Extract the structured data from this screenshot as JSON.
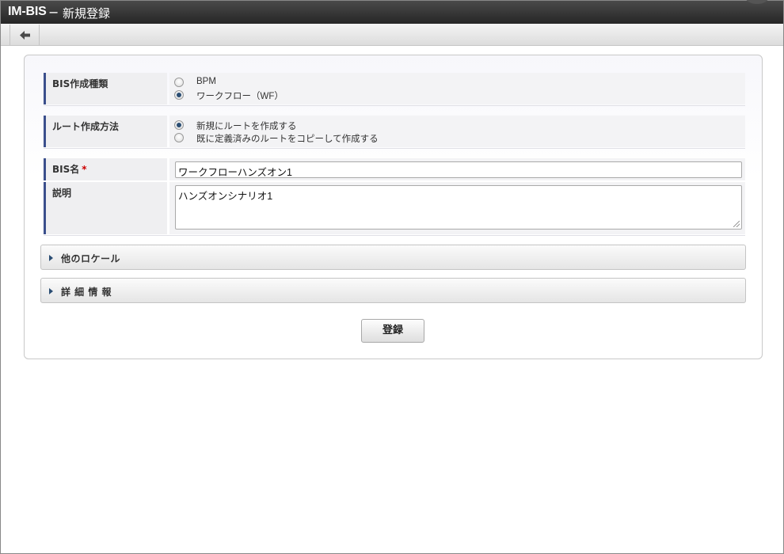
{
  "header": {
    "app_name": "IM-BIS",
    "separator": "−",
    "page_title": "新規登録"
  },
  "toolbar": {
    "back_icon": "arrow-left-icon"
  },
  "form": {
    "bis_type": {
      "label": "BIS作成種類",
      "options": [
        {
          "label": "BPM",
          "selected": false
        },
        {
          "label": "ワークフロー（WF）",
          "selected": true
        }
      ]
    },
    "route_method": {
      "label": "ルート作成方法",
      "options": [
        {
          "label": "新規にルートを作成する",
          "selected": true
        },
        {
          "label": "既に定義済みのルートをコピーして作成する",
          "selected": false
        }
      ]
    },
    "bis_name": {
      "label": "BIS名",
      "required_mark": "*",
      "value": "ワークフローハンズオン1"
    },
    "description": {
      "label": "説明",
      "value": "ハンズオンシナリオ1"
    }
  },
  "sections": [
    {
      "title": "他のロケール",
      "expanded": false
    },
    {
      "title": "詳 細 情 報",
      "expanded": false
    }
  ],
  "actions": {
    "register_label": "登録"
  },
  "colors": {
    "accent": "#3b4f8c",
    "required": "#cc0000",
    "titlebar": "#2f2f2f"
  }
}
